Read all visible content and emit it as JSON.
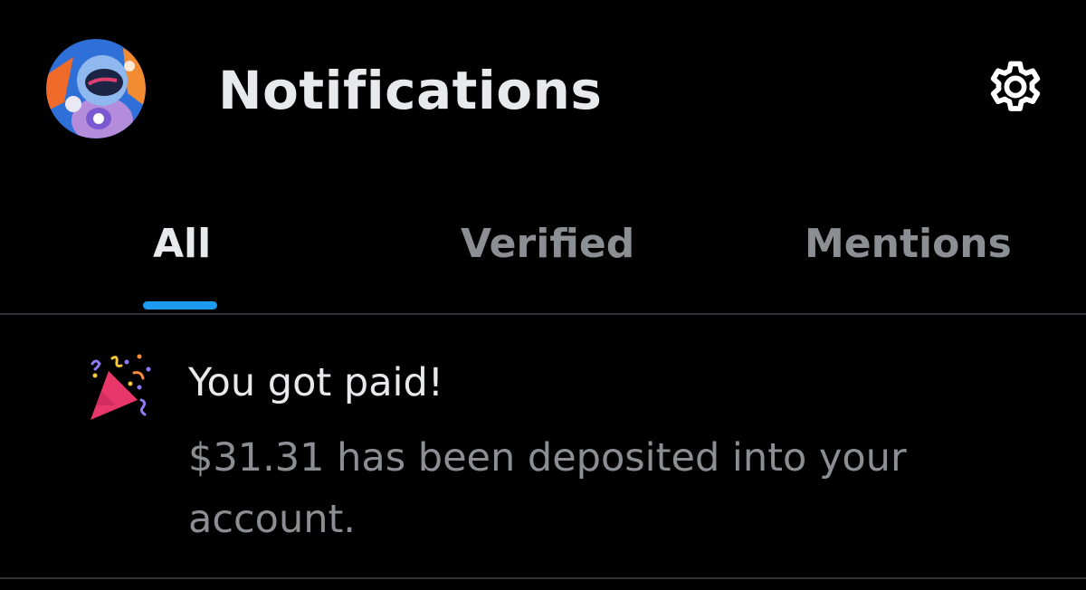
{
  "header": {
    "title": "Notifications",
    "avatar_icon": "astronaut-avatar",
    "settings_icon": "gear-icon"
  },
  "tabs": [
    {
      "label": "All",
      "active": true
    },
    {
      "label": "Verified",
      "active": false
    },
    {
      "label": "Mentions",
      "active": false
    }
  ],
  "notifications": [
    {
      "icon": "party-popper-icon",
      "title": "You got paid!",
      "body": "$31.31 has been deposited into your account."
    }
  ],
  "colors": {
    "background": "#000000",
    "text_primary": "#e7e9ea",
    "text_secondary": "#8b8f93",
    "accent": "#1d9bf0",
    "divider": "#2f3336"
  }
}
